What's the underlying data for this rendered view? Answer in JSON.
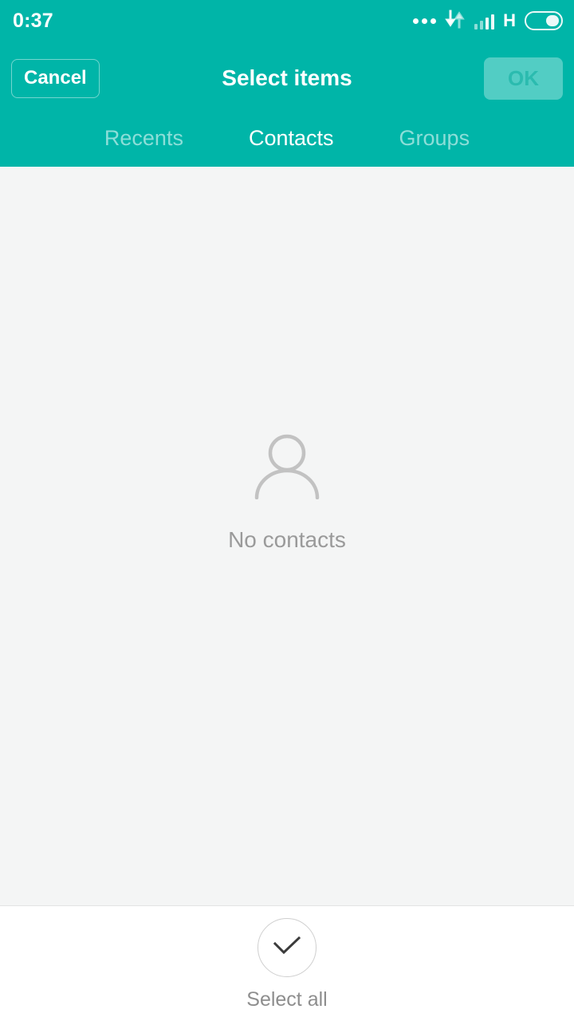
{
  "status_bar": {
    "clock": "0:37",
    "network_label": "H",
    "icons": {
      "more": "more-dots-icon",
      "data_transfer": "data-transfer-arrows-icon",
      "signal": "signal-bars-icon",
      "battery": "battery-icon"
    }
  },
  "action_bar": {
    "cancel_label": "Cancel",
    "title": "Select items",
    "ok_label": "OK",
    "ok_enabled": false
  },
  "tabs": [
    {
      "label": "Recents",
      "active": false
    },
    {
      "label": "Contacts",
      "active": true
    },
    {
      "label": "Groups",
      "active": false
    }
  ],
  "content": {
    "empty_state": {
      "icon": "person-outline-icon",
      "text": "No contacts"
    }
  },
  "bottom_bar": {
    "select_all_label": "Select all",
    "select_all_icon": "check-icon"
  },
  "colors": {
    "accent_teal": "#00b5a8",
    "header_text": "#ffffff",
    "ok_text": "#2bbbaf",
    "content_bg": "#f4f5f5",
    "muted_text": "#9a9a9a",
    "bottom_bar_bg": "#ffffff"
  }
}
